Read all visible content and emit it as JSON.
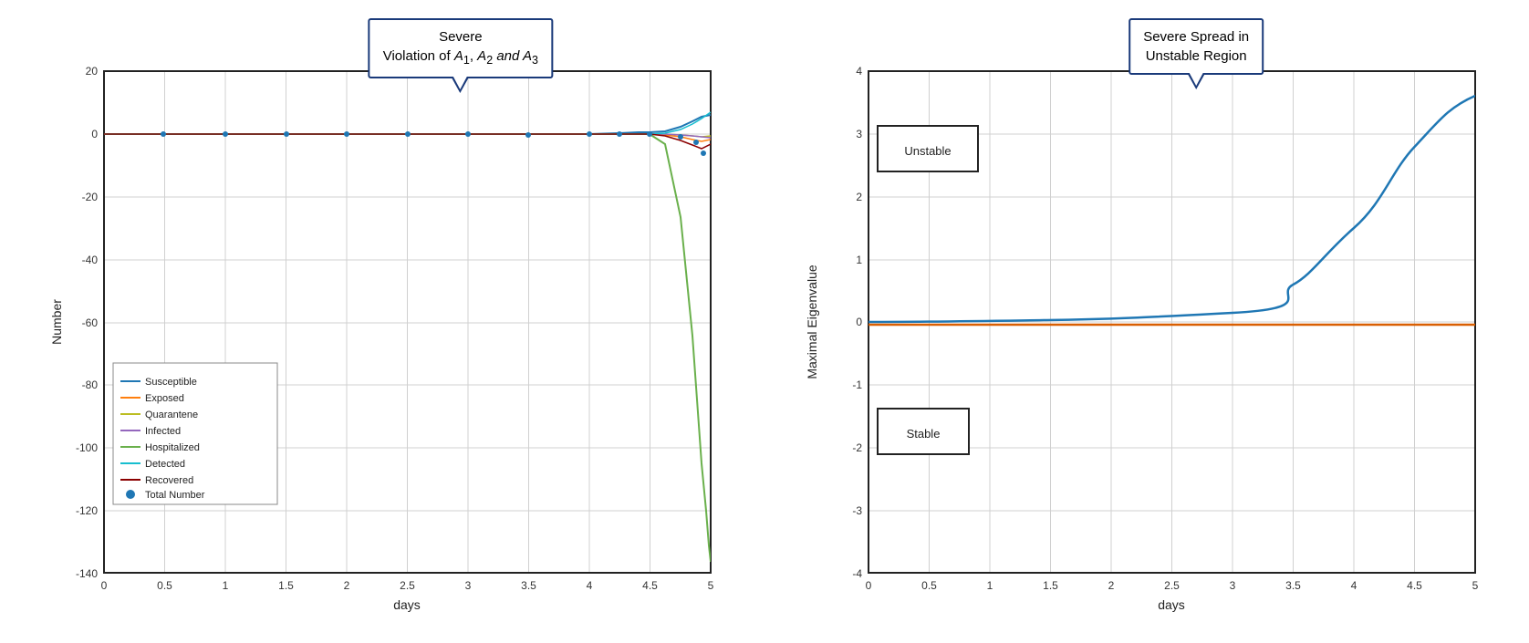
{
  "left_chart": {
    "title_callout": "Severe Violation of A₁, A₂ and A₃",
    "x_label": "days",
    "y_label": "Number",
    "x_ticks": [
      "0",
      "0.5",
      "1",
      "1.5",
      "2",
      "2.5",
      "3",
      "3.5",
      "4",
      "4.5",
      "5"
    ],
    "y_ticks": [
      "20",
      "0",
      "-20",
      "-40",
      "-60",
      "-80",
      "-100",
      "-120",
      "-140"
    ],
    "legend": [
      {
        "label": "Susceptible",
        "color": "#1f77b4",
        "type": "line"
      },
      {
        "label": "Exposed",
        "color": "#d62728",
        "type": "line"
      },
      {
        "label": "Quarantene",
        "color": "#bcbd22",
        "type": "line"
      },
      {
        "label": "Infected",
        "color": "#9467bd",
        "type": "line"
      },
      {
        "label": "Hospitalized",
        "color": "#8fbc44",
        "type": "line"
      },
      {
        "label": "Detected",
        "color": "#17becf",
        "type": "line"
      },
      {
        "label": "Recovered",
        "color": "#8b0000",
        "type": "line"
      },
      {
        "label": "Total Number",
        "color": "#1f77b4",
        "type": "dot"
      }
    ]
  },
  "right_chart": {
    "title_callout": "Severe Spread in Unstable Region",
    "x_label": "days",
    "y_label": "Maximal Eigenvalue",
    "x_ticks": [
      "0",
      "0.5",
      "1",
      "1.5",
      "2",
      "2.5",
      "3",
      "3.5",
      "4",
      "4.5",
      "5"
    ],
    "y_ticks": [
      "4",
      "3",
      "2",
      "1",
      "0",
      "-1",
      "-2",
      "-3",
      "-4"
    ],
    "unstable_label": "Unstable",
    "stable_label": "Stable"
  }
}
